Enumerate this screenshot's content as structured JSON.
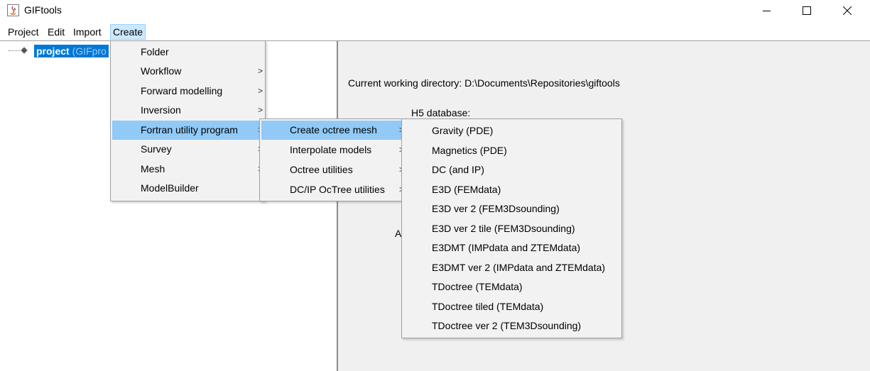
{
  "window": {
    "title": "GIFtools"
  },
  "window_controls": {
    "minimize": "—",
    "maximize": "☐",
    "close": "✕"
  },
  "menubar": {
    "project": "Project",
    "edit": "Edit",
    "import": "Import",
    "create": "Create"
  },
  "tree": {
    "root_label": "project",
    "root_suffix": "(GIFpro"
  },
  "content": {
    "cwd": "Current working directory:  D:\\Documents\\Repositories\\giftools",
    "h5": "H5 database:",
    "partial": "A"
  },
  "create_menu": {
    "items": [
      {
        "label": "Folder",
        "submenu": false
      },
      {
        "label": "Workflow",
        "submenu": true
      },
      {
        "label": "Forward modelling",
        "submenu": true
      },
      {
        "label": "Inversion",
        "submenu": true
      },
      {
        "label": "Fortran utility program",
        "submenu": true
      },
      {
        "label": "Survey",
        "submenu": true
      },
      {
        "label": "Mesh",
        "submenu": true
      },
      {
        "label": "ModelBuilder",
        "submenu": false
      }
    ],
    "highlighted": "Fortran utility program"
  },
  "fortran_menu": {
    "items": [
      {
        "label": "Create octree mesh",
        "submenu": true
      },
      {
        "label": "Interpolate models",
        "submenu": true
      },
      {
        "label": "Octree utilities",
        "submenu": true
      },
      {
        "label": "DC/IP OcTree utilities",
        "submenu": true
      }
    ],
    "highlighted": "Create octree mesh"
  },
  "octree_menu": {
    "items": [
      {
        "label": "Gravity (PDE)"
      },
      {
        "label": "Magnetics (PDE)"
      },
      {
        "label": "DC (and IP)"
      },
      {
        "label": "E3D (FEMdata)"
      },
      {
        "label": "E3D ver 2 (FEM3Dsounding)"
      },
      {
        "label": "E3D ver 2 tile (FEM3Dsounding)"
      },
      {
        "label": "E3DMT (IMPdata and ZTEMdata)"
      },
      {
        "label": "E3DMT ver 2 (IMPdata and ZTEMdata)"
      },
      {
        "label": "TDoctree (TEMdata)"
      },
      {
        "label": "TDoctree tiled (TEMdata)"
      },
      {
        "label": "TDoctree ver 2 (TEM3Dsounding)"
      }
    ]
  },
  "colors": {
    "selection": "#0078d7",
    "menu_highlight": "#91c9f7",
    "menubar_active": "#cce8ff"
  },
  "submenu_arrow": ">"
}
